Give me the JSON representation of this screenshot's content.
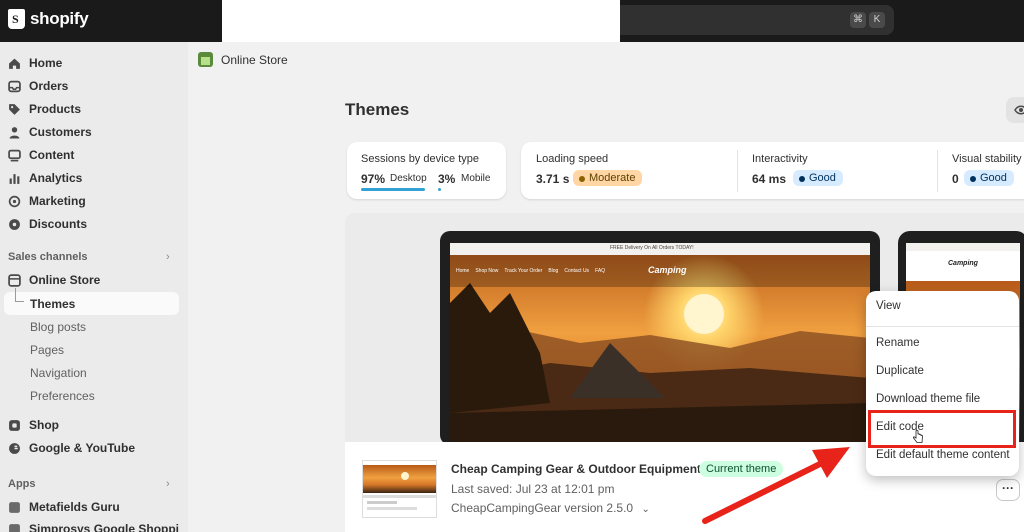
{
  "topbar": {
    "logo_text": "shopify",
    "kbd_cmd": "⌘",
    "kbd_k": "K"
  },
  "sidebar": {
    "items": [
      {
        "label": "Home",
        "icon": "home-icon"
      },
      {
        "label": "Orders",
        "icon": "orders-icon"
      },
      {
        "label": "Products",
        "icon": "tag-icon"
      },
      {
        "label": "Customers",
        "icon": "person-icon"
      },
      {
        "label": "Content",
        "icon": "content-icon"
      },
      {
        "label": "Analytics",
        "icon": "bar-chart-icon"
      },
      {
        "label": "Marketing",
        "icon": "target-icon"
      },
      {
        "label": "Discounts",
        "icon": "gear-discount-icon"
      }
    ],
    "sales_channels_label": "Sales channels",
    "online_store": "Online Store",
    "sub_items": [
      "Themes",
      "Blog posts",
      "Pages",
      "Navigation",
      "Preferences"
    ],
    "shop": "Shop",
    "google": "Google & YouTube",
    "apps_label": "Apps",
    "apps": [
      "Metafields Guru",
      "Simprosys Google Shoppi"
    ]
  },
  "breadcrumb": {
    "label": "Online Store"
  },
  "page": {
    "title": "Themes"
  },
  "metrics": {
    "sessions_label": "Sessions by device type",
    "desktop_pct": "97%",
    "desktop_label": "Desktop",
    "mobile_pct": "3%",
    "mobile_label": "Mobile",
    "loading_label": "Loading speed",
    "loading_value": "3.71 s",
    "loading_badge": "Moderate",
    "interactivity_label": "Interactivity",
    "interactivity_value": "64 ms",
    "interactivity_badge": "Good",
    "visual_label": "Visual stability",
    "visual_value": "0",
    "visual_badge": "Good"
  },
  "preview": {
    "banner": "FREE Delivery On All Orders TODAY!",
    "nav": [
      "Home",
      "Shop Now",
      "Track Your Order",
      "Blog",
      "Contact Us",
      "FAQ"
    ],
    "brand": "Camping"
  },
  "theme": {
    "name": "Cheap Camping Gear & Outdoor Equipment",
    "badge": "Current theme",
    "last_saved": "Last saved: Jul 23 at 12:01 pm",
    "version": "CheapCampingGear version 2.5.0",
    "more": "···"
  },
  "menu": {
    "items": [
      "View",
      "Rename",
      "Duplicate",
      "Download theme file",
      "Edit code",
      "Edit default theme content"
    ]
  },
  "colors": {
    "highlight": "#e8231a",
    "good_badge": "#d6ebff",
    "moderate_badge": "#ffd6a4",
    "current_theme_badge": "#cdfee1"
  }
}
